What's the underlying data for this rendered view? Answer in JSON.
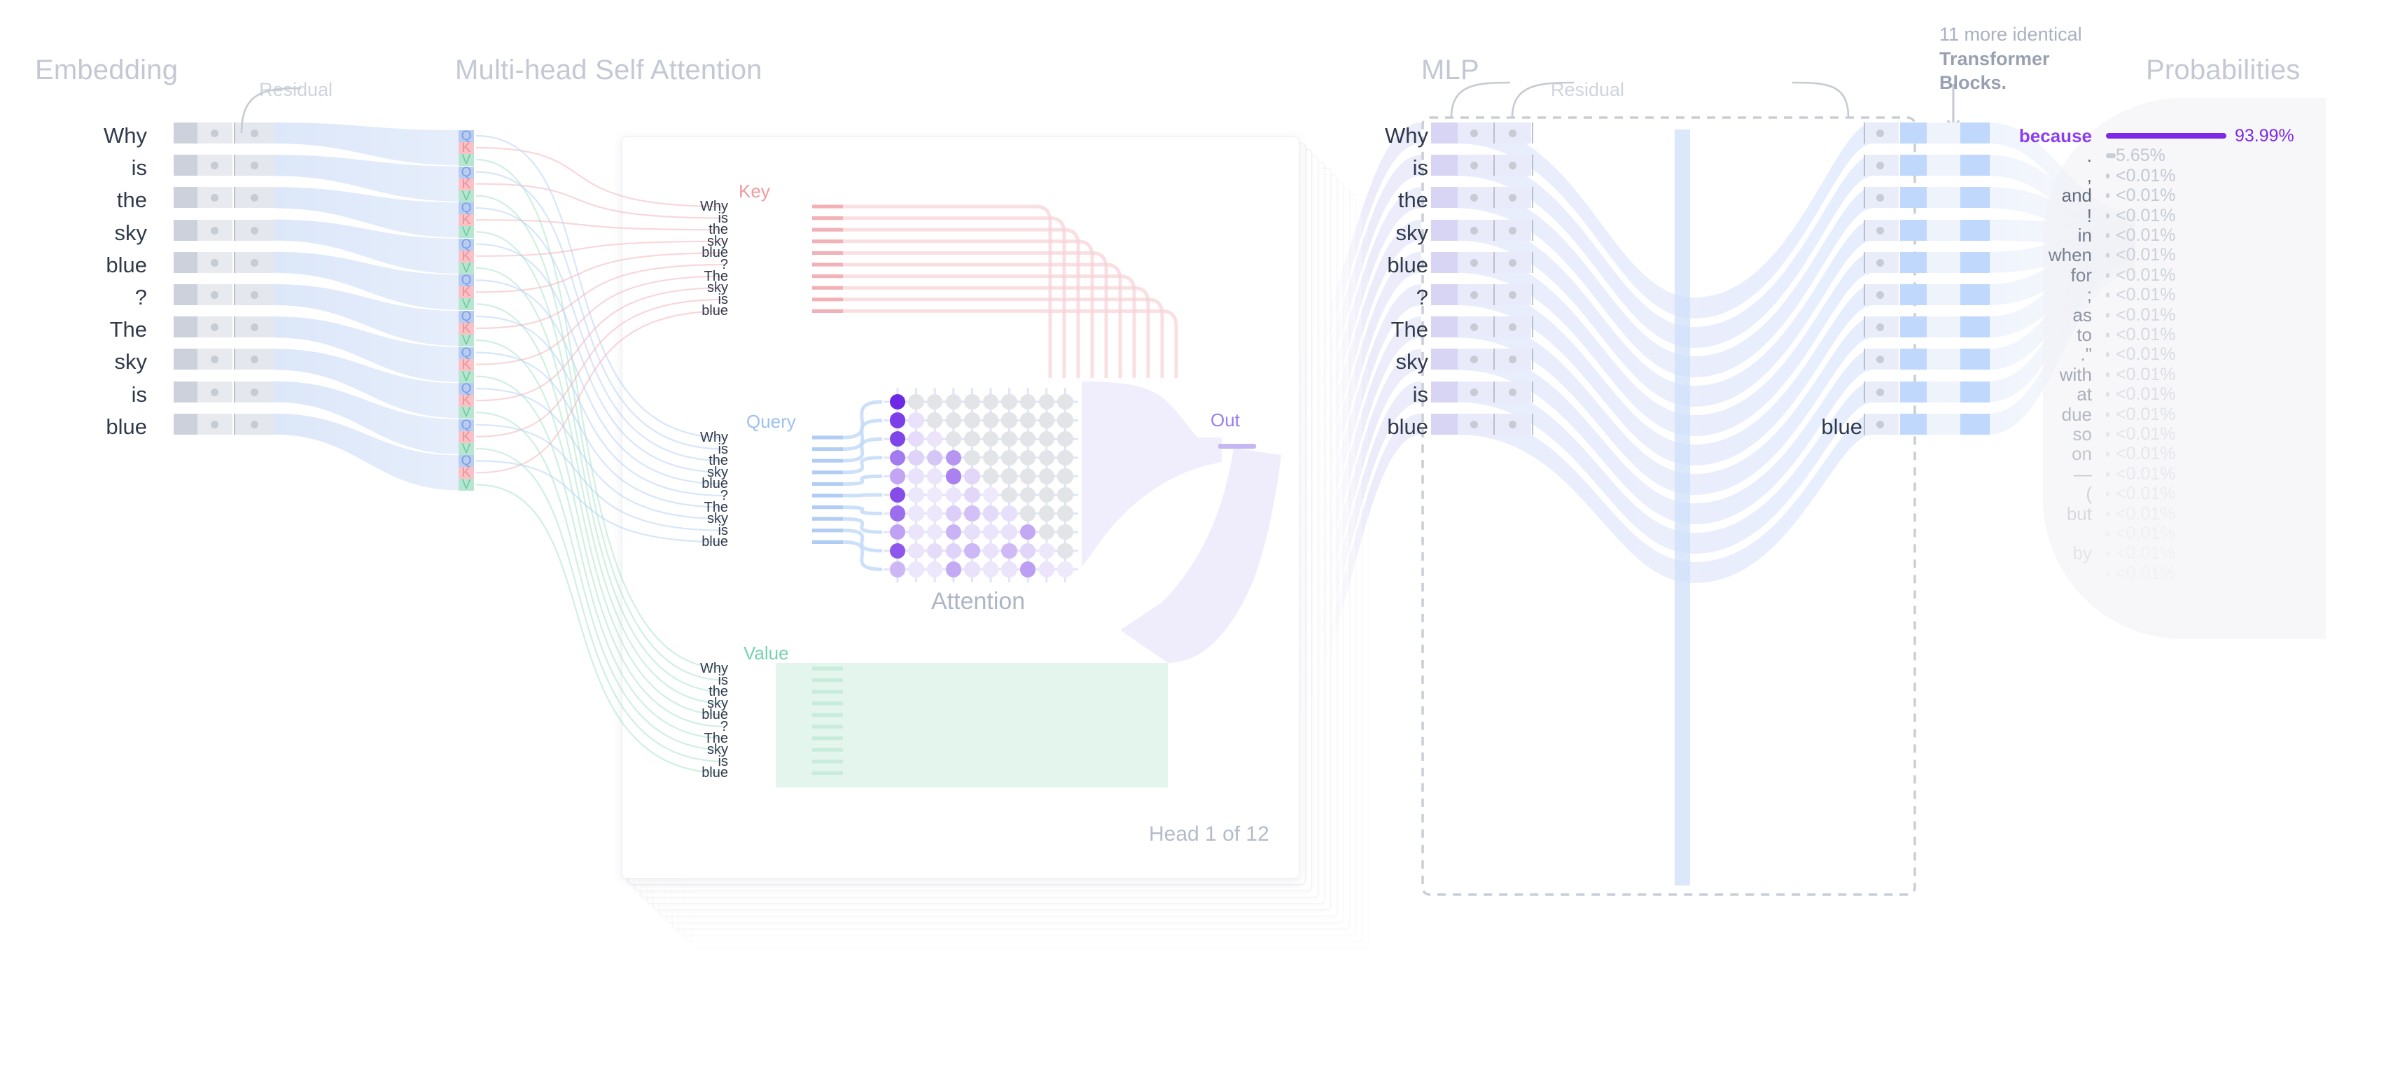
{
  "sections": {
    "embedding": "Embedding",
    "attention": "Multi-head Self Attention",
    "mlp": "MLP",
    "probabilities": "Probabilities",
    "residual_1": "Residual",
    "residual_2": "Residual"
  },
  "tokens": [
    "Why",
    "is",
    "the",
    "sky",
    "blue",
    "?",
    "The",
    "sky",
    "is",
    "blue"
  ],
  "qkv_labels": [
    "Q",
    "K",
    "V"
  ],
  "attention_panel": {
    "key_label": "Key",
    "query_label": "Query",
    "value_label": "Value",
    "out_label": "Out",
    "title": "Attention",
    "head_label": "Head 1 of 12"
  },
  "mlp_note": {
    "line1": "11 more identical",
    "line2": "Transformer",
    "line3": "Blocks.",
    "arrow": "down-arrow-icon"
  },
  "last_token_label": "blue",
  "colors": {
    "query": "#9dc0ef",
    "key": "#f09aa0",
    "value": "#76d3ab",
    "out": "#9b7ef0",
    "top_prob": "#7c2ae8",
    "token_text": "#303a4c",
    "section_title": "#c3c8d4"
  },
  "chart_data": {
    "type": "heatmap",
    "title": "Attention",
    "subtitle": "Head 1 of 12",
    "xlabel": "Key",
    "ylabel": "Query",
    "categories": [
      "Why",
      "is",
      "the",
      "sky",
      "blue",
      "?",
      "The",
      "sky",
      "is",
      "blue"
    ],
    "note": "causal (lower-triangular) self-attention matrix; value = attention weight 0..1",
    "matrix": [
      [
        1.0,
        0,
        0,
        0,
        0,
        0,
        0,
        0,
        0,
        0
      ],
      [
        0.88,
        0.08,
        0,
        0,
        0,
        0,
        0,
        0,
        0,
        0
      ],
      [
        0.84,
        0.1,
        0.07,
        0,
        0,
        0,
        0,
        0,
        0,
        0
      ],
      [
        0.56,
        0.14,
        0.2,
        0.42,
        0,
        0,
        0,
        0,
        0,
        0
      ],
      [
        0.34,
        0.08,
        0.07,
        0.52,
        0.12,
        0,
        0,
        0,
        0,
        0
      ],
      [
        0.8,
        0.06,
        0.05,
        0.07,
        0.12,
        0.05,
        0,
        0,
        0,
        0
      ],
      [
        0.62,
        0.06,
        0.06,
        0.16,
        0.22,
        0.11,
        0.09,
        0,
        0,
        0
      ],
      [
        0.36,
        0.07,
        0.06,
        0.28,
        0.09,
        0.07,
        0.08,
        0.33,
        0,
        0
      ],
      [
        0.74,
        0.07,
        0.1,
        0.14,
        0.26,
        0.08,
        0.25,
        0.13,
        0.06,
        0
      ],
      [
        0.26,
        0.06,
        0.06,
        0.32,
        0.08,
        0.06,
        0.07,
        0.38,
        0.07,
        0.05
      ]
    ]
  },
  "probabilities": {
    "header": "Probabilities",
    "items": [
      {
        "token": "because",
        "value": "93.99%",
        "pct": 93.99
      },
      {
        "token": ".",
        "value": "5.65%",
        "pct": 5.65
      },
      {
        "token": ",",
        "value": "<0.01%",
        "pct": 0.01
      },
      {
        "token": "and",
        "value": "<0.01%",
        "pct": 0.01
      },
      {
        "token": "!",
        "value": "<0.01%",
        "pct": 0.01
      },
      {
        "token": "in",
        "value": "<0.01%",
        "pct": 0.01
      },
      {
        "token": "when",
        "value": "<0.01%",
        "pct": 0.01
      },
      {
        "token": "for",
        "value": "<0.01%",
        "pct": 0.01
      },
      {
        "token": ";",
        "value": "<0.01%",
        "pct": 0.01
      },
      {
        "token": "as",
        "value": "<0.01%",
        "pct": 0.01
      },
      {
        "token": "to",
        "value": "<0.01%",
        "pct": 0.01
      },
      {
        "token": ".\"",
        "value": "<0.01%",
        "pct": 0.01
      },
      {
        "token": "with",
        "value": "<0.01%",
        "pct": 0.01
      },
      {
        "token": "at",
        "value": "<0.01%",
        "pct": 0.01
      },
      {
        "token": "due",
        "value": "<0.01%",
        "pct": 0.01
      },
      {
        "token": "so",
        "value": "<0.01%",
        "pct": 0.01
      },
      {
        "token": "on",
        "value": "<0.01%",
        "pct": 0.01
      },
      {
        "token": "—",
        "value": "<0.01%",
        "pct": 0.01
      },
      {
        "token": "(",
        "value": "<0.01%",
        "pct": 0.01
      },
      {
        "token": "but",
        "value": "<0.01%",
        "pct": 0.01
      },
      {
        "token": "",
        "value": "<0.01%",
        "pct": 0.01
      },
      {
        "token": "by",
        "value": "<0.01%",
        "pct": 0.01
      },
      {
        "token": "",
        "value": "<0.01%",
        "pct": 0.01
      }
    ]
  }
}
